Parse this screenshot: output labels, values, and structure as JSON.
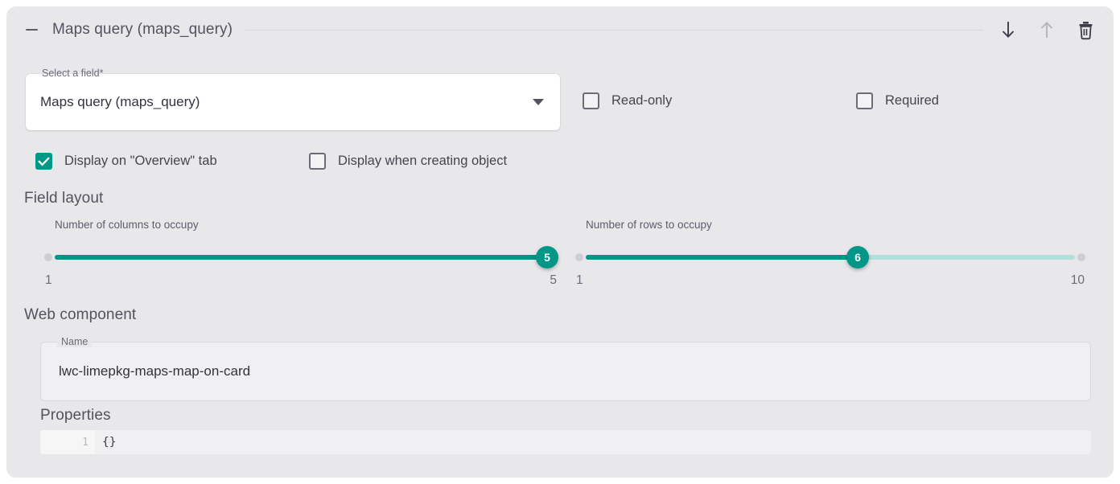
{
  "header": {
    "title": "Maps query (maps_query)",
    "collapse_icon": "minus-icon",
    "move_down_icon": "arrow-down-icon",
    "move_up_icon": "arrow-up-icon",
    "delete_icon": "trash-icon"
  },
  "select_field": {
    "legend": "Select a field*",
    "value": "Maps query (maps_query)",
    "arrow_icon": "chevron-down-icon"
  },
  "checkboxes": {
    "read_only": {
      "label": "Read-only",
      "checked": false
    },
    "required": {
      "label": "Required",
      "checked": false
    },
    "display_overview": {
      "label": "Display on \"Overview\" tab",
      "checked": true
    },
    "display_creating": {
      "label": "Display when creating object",
      "checked": false
    }
  },
  "field_layout": {
    "title": "Field layout",
    "columns_slider": {
      "label": "Number of columns to occupy",
      "value": 5,
      "min": 1,
      "max": 5,
      "min_label": "1",
      "max_label": "5",
      "fill_percent": 100
    },
    "rows_slider": {
      "label": "Number of rows to occupy",
      "value": 6,
      "min": 1,
      "max": 10,
      "min_label": "1",
      "max_label": "10",
      "fill_percent": 55.6
    }
  },
  "web_component": {
    "title": "Web component",
    "name_legend": "Name",
    "name_value": "lwc-limepkg-maps-map-on-card"
  },
  "properties": {
    "title": "Properties",
    "line_number": "1",
    "code": "{}"
  },
  "colors": {
    "accent": "#009688",
    "accent_light": "#b2dfd9",
    "card_bg": "#e8e8eb",
    "text": "#46454f"
  }
}
